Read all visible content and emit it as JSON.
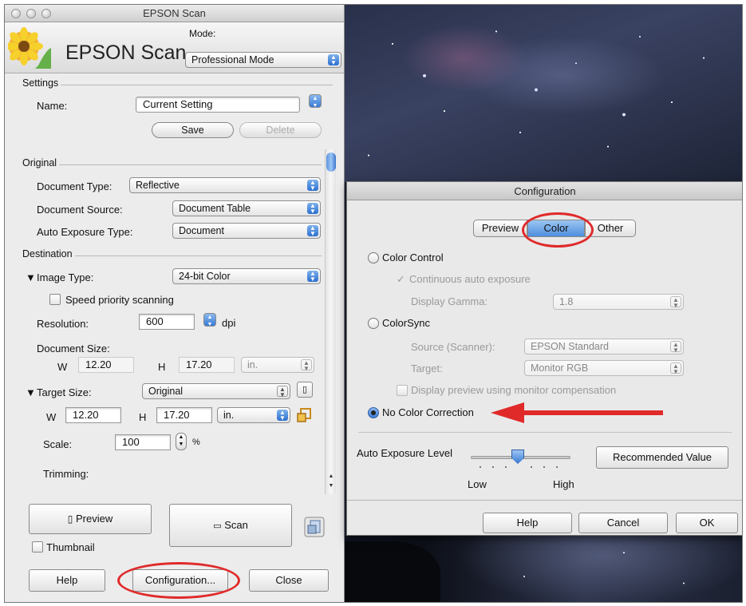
{
  "main_window": {
    "title": "EPSON Scan",
    "logo_text": "EPSON Scan",
    "mode_label": "Mode:",
    "mode_value": "Professional Mode",
    "settings": {
      "section": "Settings",
      "name_label": "Name:",
      "name_value": "Current Setting",
      "save": "Save",
      "delete": "Delete"
    },
    "original": {
      "section": "Original",
      "doc_type_label": "Document Type:",
      "doc_type_value": "Reflective",
      "doc_source_label": "Document Source:",
      "doc_source_value": "Document Table",
      "auto_exposure_label": "Auto Exposure Type:",
      "auto_exposure_value": "Document"
    },
    "destination": {
      "section": "Destination",
      "image_type_label": "Image Type:",
      "image_type_value": "24-bit Color",
      "speed_priority": "Speed priority scanning",
      "resolution_label": "Resolution:",
      "resolution_value": "600",
      "dpi": "dpi",
      "doc_size_label": "Document Size:",
      "w": "W",
      "h": "H",
      "doc_w": "12.20",
      "doc_h": "17.20",
      "doc_unit": "in."
    },
    "target": {
      "label": "Target Size:",
      "value": "Original",
      "w": "W",
      "h": "H",
      "w_value": "12.20",
      "h_value": "17.20",
      "unit": "in.",
      "scale_label": "Scale:",
      "scale_value": "100",
      "percent": "%",
      "trimming_label": "Trimming:"
    },
    "buttons": {
      "preview": "Preview",
      "scan": "Scan",
      "thumbnail": "Thumbnail",
      "help": "Help",
      "configuration": "Configuration...",
      "close": "Close"
    }
  },
  "config_dialog": {
    "title": "Configuration",
    "tabs": [
      "Preview",
      "Color",
      "Other"
    ],
    "selected_tab": "Color",
    "color_control": "Color Control",
    "continuous_auto_exposure": "Continuous auto exposure",
    "display_gamma_label": "Display Gamma:",
    "display_gamma_value": "1.8",
    "colorsync": "ColorSync",
    "source_label": "Source (Scanner):",
    "source_value": "EPSON Standard",
    "target_label": "Target:",
    "target_value": "Monitor RGB",
    "display_preview": "Display preview using monitor compensation",
    "no_color_correction": "No Color Correction",
    "auto_exposure_level_label": "Auto Exposure Level",
    "low": "Low",
    "high": "High",
    "recommended_value": "Recommended Value",
    "help": "Help",
    "cancel": "Cancel",
    "ok": "OK"
  },
  "colors": {
    "annotation_red": "#e02a2a",
    "selection_blue": "#4e8fde"
  }
}
